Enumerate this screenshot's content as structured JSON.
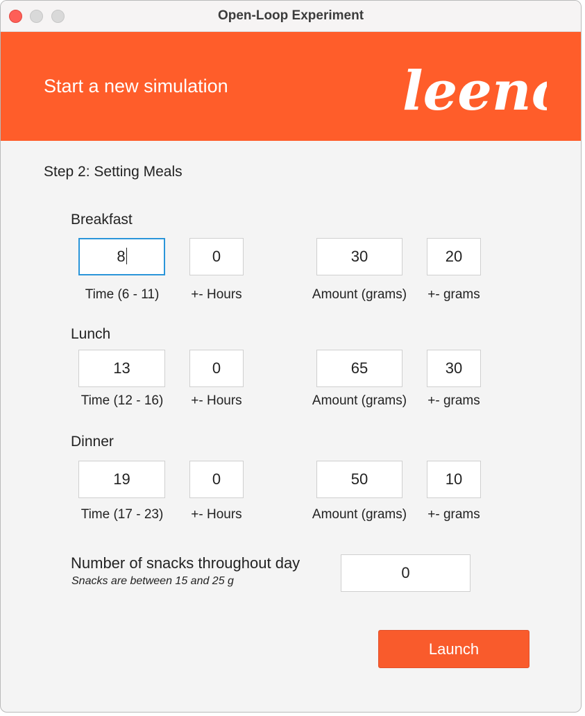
{
  "window": {
    "title": "Open-Loop Experiment"
  },
  "header": {
    "title": "Start a new simulation",
    "logo_text": "leeno",
    "color": "#ff5d2a"
  },
  "step": {
    "label": "Step 2: Setting Meals"
  },
  "meals": {
    "breakfast": {
      "label": "Breakfast",
      "time": "8",
      "hours": "0",
      "amount": "30",
      "grams": "20",
      "time_caption": "Time (6 - 11)",
      "hours_caption": "+- Hours",
      "amount_caption": "Amount (grams)",
      "grams_caption": "+- grams"
    },
    "lunch": {
      "label": "Lunch",
      "time": "13",
      "hours": "0",
      "amount": "65",
      "grams": "30",
      "time_caption": "Time (12 - 16)",
      "hours_caption": "+- Hours",
      "amount_caption": "Amount (grams)",
      "grams_caption": "+- grams"
    },
    "dinner": {
      "label": "Dinner",
      "time": "19",
      "hours": "0",
      "amount": "50",
      "grams": "10",
      "time_caption": "Time (17 - 23)",
      "hours_caption": "+- Hours",
      "amount_caption": "Amount (grams)",
      "grams_caption": "+- grams"
    }
  },
  "snacks": {
    "label": "Number of snacks throughout day",
    "note": "Snacks are between 15 and 25 g",
    "value": "0"
  },
  "launch": {
    "label": "Launch",
    "color": "#f95b2c"
  }
}
